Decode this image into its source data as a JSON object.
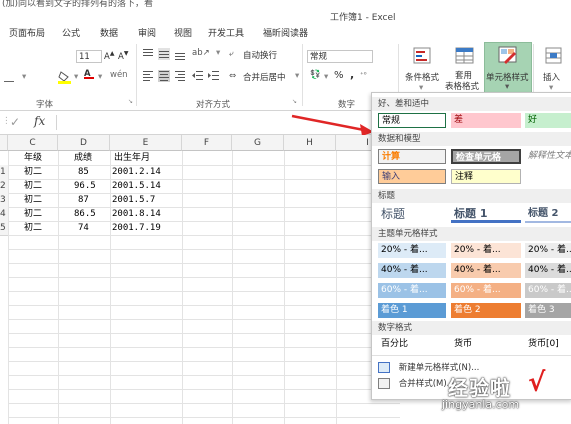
{
  "titlebar": {
    "cut_text": "(加)同以看到文字的排列有的落下，看",
    "app_title": "工作簿1 - Excel"
  },
  "tabs": [
    "页面布局",
    "公式",
    "数据",
    "审阅",
    "视图",
    "开发工具",
    "福昕阅读器"
  ],
  "ribbon": {
    "font_size": "11",
    "number_format": "常规",
    "wrap_text": "自动换行",
    "merge_center": "合并后居中",
    "percent": "%",
    "comma": ",",
    "group_labels": {
      "font": "字体",
      "alignment": "对齐方式",
      "number": "数字"
    },
    "buttons": {
      "conditional_format": "条件格式",
      "table_format_line1": "套用",
      "table_format_line2": "表格格式",
      "cell_styles": "单元格样式",
      "insert": "插入"
    },
    "accent": "#217346"
  },
  "formula_bar": {
    "cancel": "✓",
    "fx": "fx"
  },
  "sheet": {
    "columns": [
      "C",
      "D",
      "E",
      "F",
      "G",
      "H",
      "I"
    ],
    "header_row": [
      "年级",
      "成绩",
      "出生年月"
    ],
    "rows": [
      {
        "num": "1",
        "grade": "初二",
        "score": "85",
        "birth": "2001.2.14"
      },
      {
        "num": "2",
        "grade": "初二",
        "score": "96.5",
        "birth": "2001.5.14"
      },
      {
        "num": "3",
        "grade": "初二",
        "score": "87",
        "birth": "2001.5.7"
      },
      {
        "num": "4",
        "grade": "初二",
        "score": "86.5",
        "birth": "2001.8.14"
      },
      {
        "num": "5",
        "grade": "初二",
        "score": "74",
        "birth": "2001.7.19"
      }
    ]
  },
  "styles_panel": {
    "section_good": "好、差和适中",
    "normal": "常规",
    "bad": "差",
    "good": "好",
    "section_data": "数据和模型",
    "calc": "计算",
    "check": "检查单元格",
    "explain": "解释性文本",
    "input": "输入",
    "note": "注释",
    "section_title": "标题",
    "title": "标题",
    "heading1": "标题 1",
    "heading2": "标题 2",
    "section_theme": "主题单元格样式",
    "theme_rows": [
      [
        "20% - 着...",
        "20% - 着...",
        "20% - 着..."
      ],
      [
        "40% - 着...",
        "40% - 着...",
        "40% - 着..."
      ],
      [
        "60% - 着...",
        "60% - 着...",
        "60% - 着..."
      ],
      [
        "着色 1",
        "着色 2",
        "着色 3"
      ]
    ],
    "section_number": "数字格式",
    "percent": "百分比",
    "currency": "货币",
    "currency0": "货币[0]",
    "new_style": "新建单元格样式(N)...",
    "merge_style": "合并样式(M)..."
  },
  "watermark": {
    "main": "经验啦",
    "check": "√",
    "url": "jingyanla.com"
  }
}
